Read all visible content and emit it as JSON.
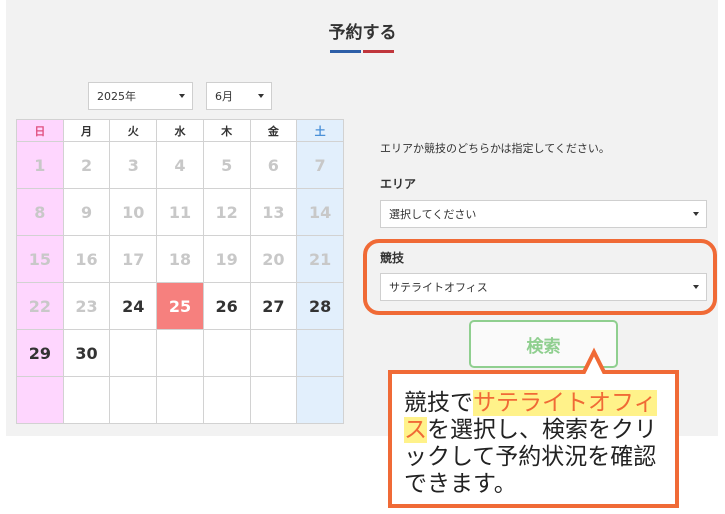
{
  "page": {
    "title": "予約する"
  },
  "calendar": {
    "year": "2025年",
    "month": "6月",
    "weekdays": [
      "日",
      "月",
      "火",
      "水",
      "木",
      "金",
      "土"
    ],
    "weeks": [
      [
        "1",
        "2",
        "3",
        "4",
        "5",
        "6",
        "7"
      ],
      [
        "8",
        "9",
        "10",
        "11",
        "12",
        "13",
        "14"
      ],
      [
        "15",
        "16",
        "17",
        "18",
        "19",
        "20",
        "21"
      ],
      [
        "22",
        "23",
        "24",
        "25",
        "26",
        "27",
        "28"
      ],
      [
        "29",
        "30",
        "",
        "",
        "",
        "",
        ""
      ],
      [
        "",
        "",
        "",
        "",
        "",
        "",
        ""
      ]
    ],
    "available_days": [
      "24",
      "25",
      "26",
      "27",
      "28",
      "29",
      "30"
    ],
    "selected_day": "25"
  },
  "form": {
    "instruction": "エリアか競技のどちらかは指定してください。",
    "area_label": "エリア",
    "area_value": "選択してください",
    "sport_label": "競技",
    "sport_value": "サテライトオフィス",
    "search_label": "検索"
  },
  "callout": {
    "prefix": "競技で",
    "highlight": "サテライトオフィス",
    "suffix": "を選択し、検索をクリックして予約状況を確認できます。"
  },
  "colors": {
    "accent_orange": "#f06a36",
    "today_red": "#f6807e",
    "search_green": "#8fcf8f",
    "sunday_pink": "#fed6fe",
    "saturday_blue": "#e2effc",
    "title_blue": "#2d5fa8",
    "title_red": "#c0363c"
  }
}
